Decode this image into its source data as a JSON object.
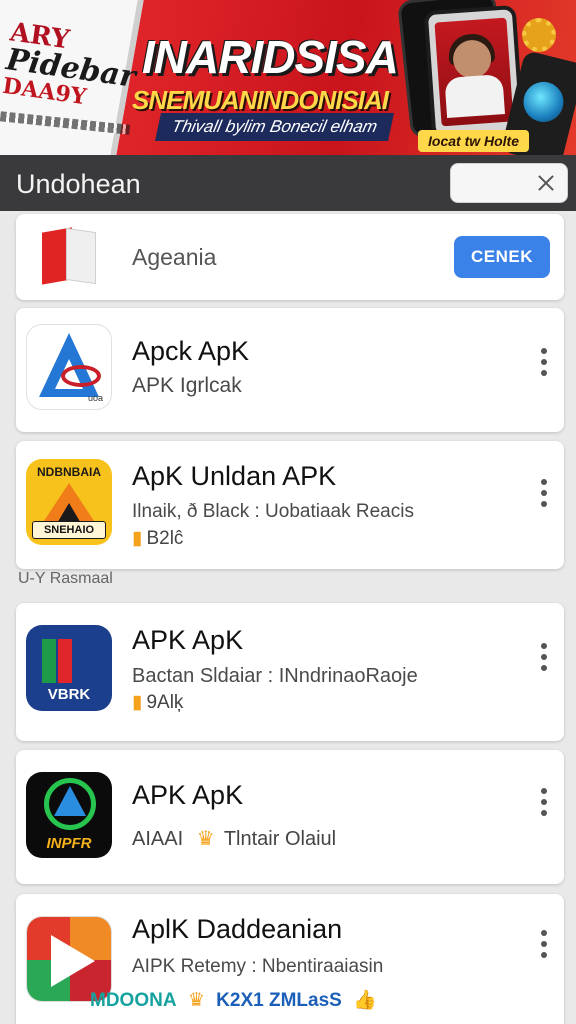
{
  "banner": {
    "left_text_1": "ARY",
    "left_text_2": "Pidebar",
    "left_text_3": "DAA9Y",
    "title": "INARIDSISA",
    "subtitle": "SNEMUANINDONISIAI",
    "tagline": "Thivall bylim Bonecil elham",
    "badge": "Iocat tw Holte",
    "colors": {
      "red": "#c9141c",
      "yellow": "#ffd84a",
      "navy": "#1c2a5c"
    }
  },
  "header": {
    "title": "Undohean",
    "search_value": "",
    "icon": "close-icon"
  },
  "featured": {
    "label": "Ageania",
    "button_label": "CENEK",
    "icon": "book-icon"
  },
  "section_label": "U-Y Rasmaal",
  "apps": [
    {
      "name": "Apck ApK",
      "subtitle": "APK Igrlcak",
      "meta": ""
    },
    {
      "name": "ApK Unldan APK",
      "subtitle": "Ilnaik, ð Black : Uobatiaak Reacis",
      "meta": "B2lĉ"
    },
    {
      "name": "APK ApK",
      "subtitle": "Bactan Sldaiar : INndrinaoRaoje",
      "meta": "9Alķ"
    },
    {
      "name": "APK ApK",
      "subtitle": "AIAAI",
      "meta": "Tlntair Olaiul"
    },
    {
      "name": "AplK Daddeanian",
      "subtitle": "AIPK Retemy : Nbentiraaiasin",
      "meta": ""
    }
  ],
  "app_icons": {
    "icon_2_top": "NDBNBAIA",
    "icon_2_bottom": "SNEHAIO",
    "icon_3_label": "VBRK",
    "icon_4_label": "INPFR",
    "icon_1_small": "uoa"
  },
  "bottom_tags": {
    "tag1": "MDOONA",
    "tag2": "K2X1 ZMLasS"
  }
}
